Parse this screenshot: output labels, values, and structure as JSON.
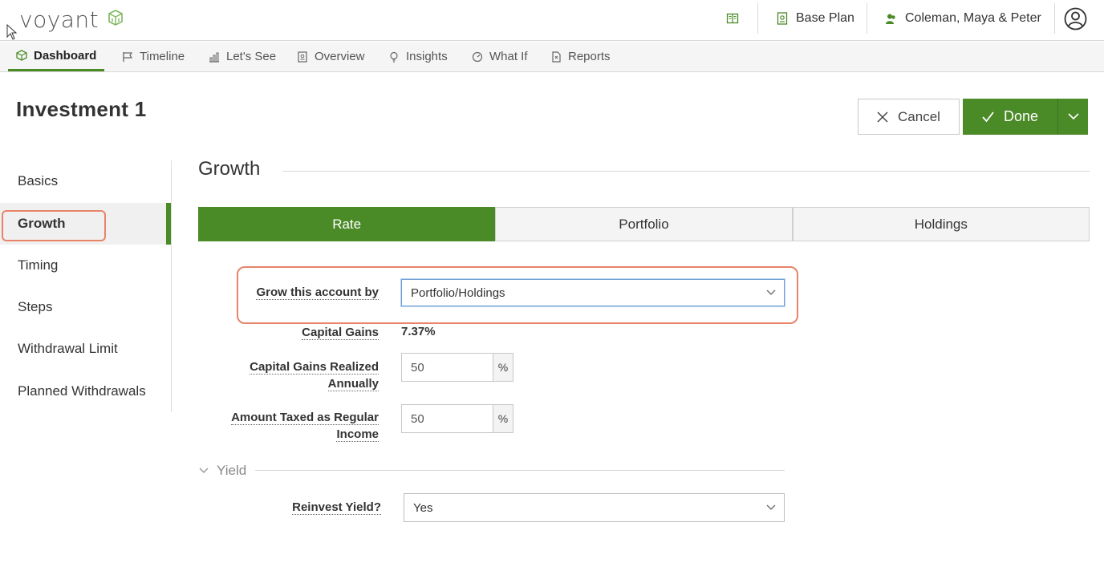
{
  "header": {
    "logo_text": "voyant",
    "plan_label": "Base Plan",
    "clients_label": "Coleman, Maya & Peter"
  },
  "nav": {
    "items": [
      {
        "label": "Dashboard",
        "icon": "cube-icon"
      },
      {
        "label": "Timeline",
        "icon": "flag-icon"
      },
      {
        "label": "Let's See",
        "icon": "bar-chart-icon"
      },
      {
        "label": "Overview",
        "icon": "document-icon"
      },
      {
        "label": "Insights",
        "icon": "lightbulb-icon"
      },
      {
        "label": "What If",
        "icon": "gauge-icon"
      },
      {
        "label": "Reports",
        "icon": "report-icon"
      }
    ],
    "active": "Dashboard"
  },
  "page": {
    "title": "Investment 1",
    "cancel_label": "Cancel",
    "done_label": "Done"
  },
  "sidebar": {
    "items": [
      {
        "label": "Basics"
      },
      {
        "label": "Growth"
      },
      {
        "label": "Timing"
      },
      {
        "label": "Steps"
      },
      {
        "label": "Withdrawal Limit"
      },
      {
        "label": "Planned Withdrawals"
      }
    ],
    "active": "Growth"
  },
  "growth": {
    "title": "Growth",
    "tabs": [
      {
        "label": "Rate"
      },
      {
        "label": "Portfolio"
      },
      {
        "label": "Holdings"
      }
    ],
    "active_tab": "Rate",
    "grow_label": "Grow this account by",
    "grow_value": "Portfolio/Holdings",
    "capital_gains_label": "Capital Gains",
    "capital_gains_value": "7.37%",
    "cg_realized_label_1": "Capital Gains Realized",
    "cg_realized_label_2": "Annually",
    "cg_realized_value": "50",
    "taxed_label_1": "Amount Taxed as Regular",
    "taxed_label_2": "Income",
    "taxed_value": "50",
    "percent_unit": "%",
    "yield_label": "Yield",
    "reinvest_label": "Reinvest Yield?",
    "reinvest_value": "Yes"
  },
  "colors": {
    "brand_green": "#4a8a27",
    "highlight": "#e8846a"
  }
}
